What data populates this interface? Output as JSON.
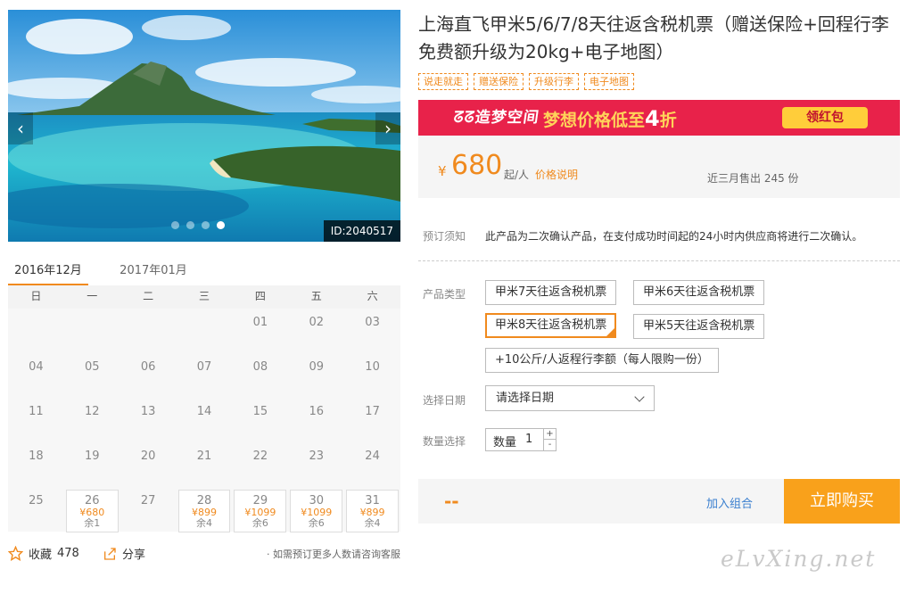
{
  "hero": {
    "id_tag": "ID:2040517",
    "slide_count": 4,
    "active_slide": 4,
    "prev_glyph": "‹",
    "next_glyph": "›"
  },
  "calendar": {
    "tabs": [
      "2016年12月",
      "2017年01月"
    ],
    "active_tab": 0,
    "weekdays": [
      "日",
      "一",
      "二",
      "三",
      "四",
      "五",
      "六"
    ],
    "weeks": [
      [
        {
          "day": ""
        },
        {
          "day": ""
        },
        {
          "day": ""
        },
        {
          "day": ""
        },
        {
          "day": "01"
        },
        {
          "day": "02"
        },
        {
          "day": "03"
        }
      ],
      [
        {
          "day": "04"
        },
        {
          "day": "05"
        },
        {
          "day": "06"
        },
        {
          "day": "07"
        },
        {
          "day": "08"
        },
        {
          "day": "09"
        },
        {
          "day": "10"
        }
      ],
      [
        {
          "day": "11"
        },
        {
          "day": "12"
        },
        {
          "day": "13"
        },
        {
          "day": "14"
        },
        {
          "day": "15"
        },
        {
          "day": "16"
        },
        {
          "day": "17"
        }
      ],
      [
        {
          "day": "18"
        },
        {
          "day": "19"
        },
        {
          "day": "20"
        },
        {
          "day": "21"
        },
        {
          "day": "22"
        },
        {
          "day": "23"
        },
        {
          "day": "24"
        }
      ],
      [
        {
          "day": "25"
        },
        {
          "day": "26",
          "price": "¥680",
          "stock": "余1"
        },
        {
          "day": "27"
        },
        {
          "day": "28",
          "price": "¥899",
          "stock": "余4"
        },
        {
          "day": "29",
          "price": "¥1099",
          "stock": "余6"
        },
        {
          "day": "30",
          "price": "¥1099",
          "stock": "余6"
        },
        {
          "day": "31",
          "price": "¥899",
          "stock": "余4"
        }
      ]
    ]
  },
  "footer": {
    "fav_label": "收藏",
    "fav_count": "478",
    "share_label": "分享",
    "consult": "· 如需预订更多人数请咨询客服"
  },
  "product": {
    "title": "上海直飞甲米5/6/7/8天往返含税机票（赠送保险+回程行李免费额升级为20kg+电子地图）",
    "tags": [
      "说走就走",
      "赠送保险",
      "升级行李",
      "电子地图"
    ]
  },
  "banner": {
    "logo_text": "ᘔᘔ造梦空间",
    "slogan": "梦想价格低至",
    "slogan_num": "4",
    "slogan_end": "折",
    "button": "领红包",
    "bg_color": "#e8224a"
  },
  "price": {
    "currency": "¥",
    "amount": "680",
    "unit": "起/人",
    "explain": "价格说明",
    "sold": "近三月售出 245 份"
  },
  "notice": {
    "label": "预订须知",
    "text": "此产品为二次确认产品，在支付成功时间起的24小时内供应商将进行二次确认。"
  },
  "form": {
    "type_label": "产品类型",
    "options": [
      "甲米7天往返含税机票",
      "甲米6天往返含税机票",
      "甲米8天往返含税机票",
      "甲米5天往返含税机票",
      "+10公斤/人返程行李额（每人限购一份）"
    ],
    "selected_option": 2,
    "date_label": "选择日期",
    "date_placeholder": "请选择日期",
    "qty_label": "数量选择",
    "qty_inner_label": "数量",
    "qty_value": "1",
    "plus": "+",
    "minus": "-"
  },
  "buy": {
    "total": "--",
    "combo": "加入组合",
    "buy_now": "立即购买",
    "accent": "#f9a11b"
  },
  "watermark": "eLvXing.net"
}
